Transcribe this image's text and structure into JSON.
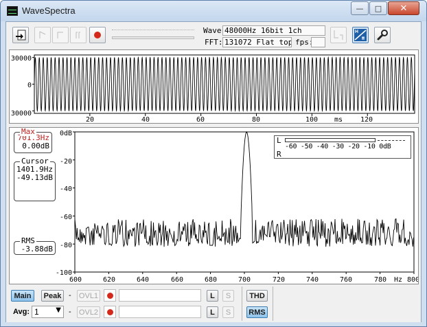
{
  "window": {
    "title": "WaveSpectra"
  },
  "toolbar": {
    "wave_label": "Wave:",
    "wave_value": "48000Hz 16bit 1ch",
    "fft_label": "FFT:",
    "fft_value": "131072 Flat top",
    "fps_label": "fps:",
    "fps_value": ""
  },
  "wave_chart": {
    "y_ticks": [
      "30000",
      "0",
      "-30000"
    ],
    "x_ticks": [
      "20",
      "40",
      "60",
      "80",
      "100",
      "120"
    ],
    "x_unit": "ms"
  },
  "readouts": {
    "max_caption": "Max",
    "max_freq": "701.3Hz",
    "max_level": "0.00dB",
    "cursor_caption": "Cursor",
    "cursor_freq": "1401.9Hz",
    "cursor_level": "-49.13dB",
    "rms_caption": "RMS",
    "rms_value": "-3.88dB"
  },
  "level_meter": {
    "left_label": "L",
    "right_label": "R",
    "scale": "-60 -50 -40 -30 -20 -10 0dB"
  },
  "chart_data": [
    {
      "type": "line",
      "name": "waveform",
      "xlabel": "ms",
      "xlim": [
        0,
        137
      ],
      "ylim": [
        -32768,
        32767
      ],
      "x_ticks": [
        20,
        40,
        60,
        80,
        100,
        120
      ],
      "y_ticks": [
        30000,
        0,
        -30000
      ],
      "signal": {
        "frequency_hz": 701.3,
        "amplitude": 30000
      }
    },
    {
      "type": "line",
      "name": "spectrum",
      "xlabel": "Hz",
      "xlim": [
        600,
        800
      ],
      "ylim": [
        -100,
        0
      ],
      "x_ticks": [
        600,
        620,
        640,
        660,
        680,
        700,
        720,
        740,
        760,
        780,
        800
      ],
      "y_ticks": [
        "0dB",
        "-20",
        "-40",
        "-60",
        "-80",
        "-100"
      ],
      "peak": {
        "x": 701.3,
        "y": 0.0
      },
      "noise_floor": [
        -60,
        -82
      ]
    }
  ],
  "bottom": {
    "main_label": "Main",
    "peak_label": "Peak",
    "dash": "-",
    "ovl1_label": "OVL1",
    "ovl2_label": "OVL2",
    "l_label": "L",
    "s_label": "S",
    "thd_label": "THD",
    "rms_label": "RMS",
    "avg_label": "Avg:",
    "avg_value": "1"
  },
  "colors": {
    "accent": "#d42a1b",
    "active_button": "#8fc3eb",
    "max_caption": "#c0201b"
  }
}
